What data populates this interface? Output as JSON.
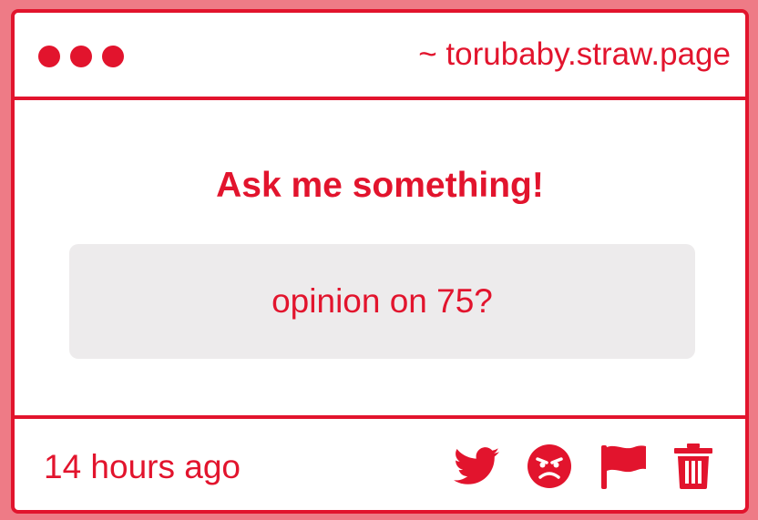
{
  "header": {
    "url": "~ torubaby.straw.page"
  },
  "main": {
    "title": "Ask me something!",
    "question": "opinion on 75?"
  },
  "footer": {
    "timestamp": "14 hours ago",
    "actions": [
      "twitter-share",
      "angry-react",
      "report-flag",
      "delete"
    ]
  },
  "colors": {
    "accent": "#e2142d",
    "background": "#ee7b86",
    "question_box": "#edebec"
  }
}
